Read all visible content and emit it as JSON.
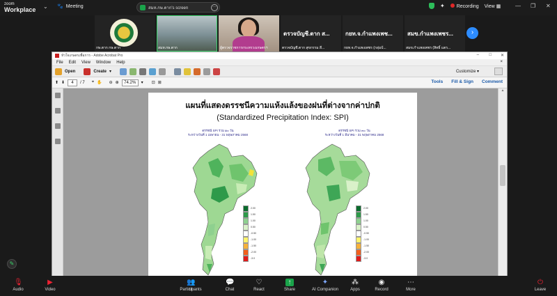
{
  "zoom": {
    "brand_line1": "zoom",
    "brand_line2": "Workplace",
    "meeting_label": "Meeting",
    "screen_share_label": "สมห.กษ.ตาก's screen",
    "recording_label": "Recording",
    "view_label": "View"
  },
  "participants_strip": [
    {
      "name": "กษ.ตาก กษ.ตาก",
      "display": "seal"
    },
    {
      "name": "สมห.กษ.ตาก",
      "display": "video-room"
    },
    {
      "name": "ผู้ตรวจราชการกระทรวงเกษตรฯ",
      "display": "video-person"
    },
    {
      "name": "ตรวจบัญชี.ตาก ส...",
      "sub": "ตรวจบัญชี.ตาก สุขกรรม สี...",
      "display": "text"
    },
    {
      "name": "กยท.จ.กำแพงเพช...",
      "sub": "กยท.จ.กำแพงเพชร (กลุ่มบ้...",
      "display": "text"
    },
    {
      "name": "สมข.กำแพงเพชร...",
      "sub": "สมข.กำแพงเพชร (สิทธิ์ แตร...",
      "display": "text"
    }
  ],
  "acrobat": {
    "title": "หัวใจเกษตรเพื่อการ - Adobe Acrobat Pro",
    "menu": [
      "File",
      "Edit",
      "View",
      "Window",
      "Help"
    ],
    "toolbar": {
      "open": "Open",
      "create": "Create",
      "customize": "Customize"
    },
    "nav": {
      "page_current": "4",
      "page_total": "/ 7",
      "zoom": "74.2%"
    },
    "right_tabs": [
      "Tools",
      "Fill & Sign",
      "Comment"
    ]
  },
  "document": {
    "title": "แผนที่แสดงดรรชนีความแห้งแล้งของฝนที่ต่างจากค่าปกติ",
    "subtitle": "(Standardized Precipitation Index: SPI)",
    "map_left": {
      "line1": "ดรรชนี SPI รวม ๑๐ วัน",
      "line2": "ระหว่างวันที่ 1 เมษายน - 31 พฤษภาคม 2568"
    },
    "map_right": {
      "line1": "ดรรชนี SPI รวม ๓๐ วัน",
      "line2": "ระหว่างวันที่ 1 มีนาคม - 31 พฤษภาคม 2568"
    },
    "legend_colors": [
      "#0a6b2c",
      "#2e9a4a",
      "#8ed08f",
      "#d9f1c9",
      "#ffffff",
      "#fff36b",
      "#f6b13a",
      "#f2601d",
      "#e01b1b"
    ],
    "legend_labels": [
      "2.00",
      "1.50",
      "1.00",
      "0.50",
      "-0.50",
      "-1.00",
      "-1.50",
      "-2.00",
      "-3.0"
    ]
  },
  "controls": {
    "audio": "Audio",
    "video": "Video",
    "participants": "Participants",
    "participants_count": "11",
    "chat": "Chat",
    "react": "React",
    "share": "Share",
    "ai": "AI Companion",
    "apps": "Apps",
    "record": "Record",
    "more": "More",
    "leave": "Leave"
  }
}
